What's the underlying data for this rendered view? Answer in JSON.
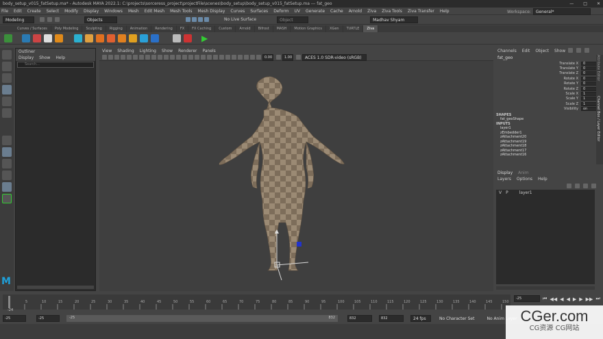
{
  "window": {
    "title": "body_setup_v015_fatSetup.ma* - Autodesk MAYA 2022.1: C:\\projects\\sorceress_project\\projectFile\\scenes\\body_setup\\body_setup_v015_fatSetup.ma  ---  fat_geo"
  },
  "menubar": [
    "File",
    "Edit",
    "Create",
    "Select",
    "Modify",
    "Display",
    "Windows",
    "Mesh",
    "Edit Mesh",
    "Mesh Tools",
    "Mesh Display",
    "Curves",
    "Surfaces",
    "Deform",
    "UV",
    "Generate",
    "Cache",
    "Arnold",
    "Ziva",
    "Ziva Tools",
    "Ziva Transfer",
    "Help"
  ],
  "workspace": {
    "label": "Workspace:",
    "value": "General*"
  },
  "status": {
    "mode": "Modeling",
    "objects": "Objects",
    "live": "No Live Surface",
    "search_placeholder": "Object",
    "user": "Madhav Shyam"
  },
  "shelf_tabs": [
    "Curves / Surfaces",
    "Poly Modeling",
    "Sculpting",
    "Rigging",
    "Animation",
    "Rendering",
    "FX",
    "FX Caching",
    "Custom",
    "Arnold",
    "Bifrost",
    "MASH",
    "Motion Graphics",
    "XGen",
    "TURTLE",
    "Ziva"
  ],
  "shelf_active": "Ziva",
  "outliner": {
    "title": "Outliner",
    "menu": [
      "Display",
      "Show",
      "Help"
    ],
    "search_placeholder": "Search..."
  },
  "viewport": {
    "menu": [
      "View",
      "Shading",
      "Lighting",
      "Show",
      "Renderer",
      "Panels"
    ],
    "exposure": "0.00",
    "gamma": "1.00",
    "colorspace": "ACES 1.0 SDR-video (sRGB)"
  },
  "channelbox": {
    "menu": [
      "Channels",
      "Edit",
      "Object",
      "Show"
    ],
    "object": "fat_geo",
    "attrs": [
      {
        "n": "Translate X",
        "v": "0"
      },
      {
        "n": "Translate Y",
        "v": "0"
      },
      {
        "n": "Translate Z",
        "v": "0"
      },
      {
        "n": "Rotate X",
        "v": "0"
      },
      {
        "n": "Rotate Y",
        "v": "0"
      },
      {
        "n": "Rotate Z",
        "v": "0"
      },
      {
        "n": "Scale X",
        "v": "1"
      },
      {
        "n": "Scale Y",
        "v": "1"
      },
      {
        "n": "Scale Z",
        "v": "1"
      },
      {
        "n": "Visibility",
        "v": "on"
      }
    ],
    "shapes_label": "SHAPES",
    "shape": "fat_geoShape",
    "inputs_label": "INPUTS",
    "inputs": [
      "layer1",
      "zEmbedder1",
      "zAttachment20",
      "zAttachment19",
      "zAttachment18",
      "zAttachment17",
      "zAttachment16"
    ]
  },
  "side_tabs": [
    "Attribute Editor",
    "Channel Box / Layer Editor"
  ],
  "layers": {
    "tabs": [
      "Display",
      "Anim"
    ],
    "menu": [
      "Layers",
      "Options",
      "Help"
    ],
    "row": {
      "v": "V",
      "p": "P",
      "name": "layer1"
    }
  },
  "timeline": {
    "ticks": [
      "5",
      "10",
      "15",
      "20",
      "25",
      "30",
      "35",
      "40",
      "45",
      "50",
      "55",
      "60",
      "65",
      "70",
      "75",
      "80",
      "85",
      "90",
      "95",
      "100",
      "105",
      "110",
      "115",
      "120",
      "125",
      "130",
      "135",
      "140",
      "145",
      "150"
    ],
    "current": "-25",
    "start_marker": "-24"
  },
  "range": {
    "start": "-25",
    "start2": "-25",
    "range_label": "-25",
    "end_label": "832",
    "end": "832",
    "end2": "832",
    "fps": "24 fps"
  },
  "bottom": {
    "character": "No Character Set",
    "anim_layer": "No Anim Layer"
  },
  "watermark": {
    "brand": "CGer.com",
    "sub": "CG资源 CG网站"
  }
}
